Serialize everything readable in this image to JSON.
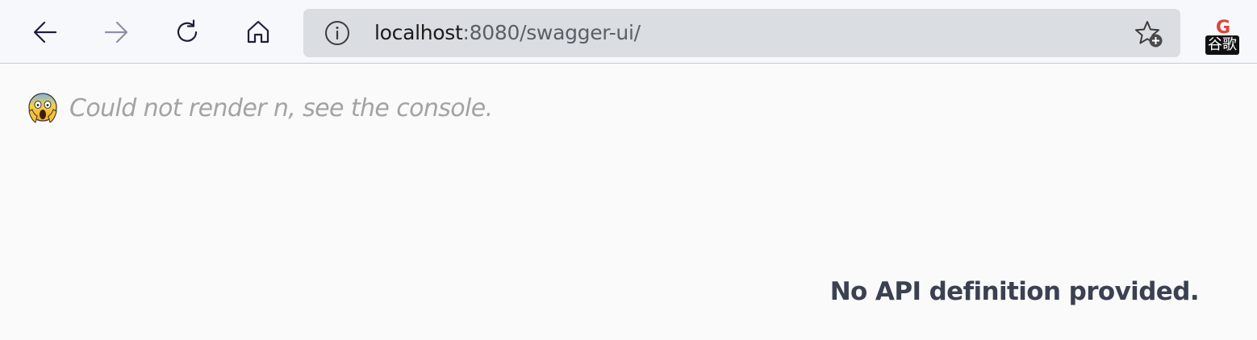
{
  "browser": {
    "address_bar": {
      "url_host": "localhost",
      "url_rest": ":8080/swagger-ui/"
    },
    "extension": {
      "icon_letter": "G",
      "badge_text": "谷歌"
    },
    "icons": {
      "back": "arrow-left-icon",
      "forward": "arrow-right-icon",
      "refresh": "refresh-icon",
      "home": "home-icon",
      "site_info": "info-icon",
      "favorite": "star-plus-icon"
    },
    "colors": {
      "toolbar_bg": "#f7f8fc",
      "address_bg": "#dadde2",
      "tab_accent": "#4f86c6"
    }
  },
  "page": {
    "error_message": "Could not render n, see the console.",
    "no_api_message": "No API definition provided.",
    "colors": {
      "background": "#fafafa",
      "error_text": "#a3a3a3",
      "heading_text": "#3b4151"
    }
  }
}
